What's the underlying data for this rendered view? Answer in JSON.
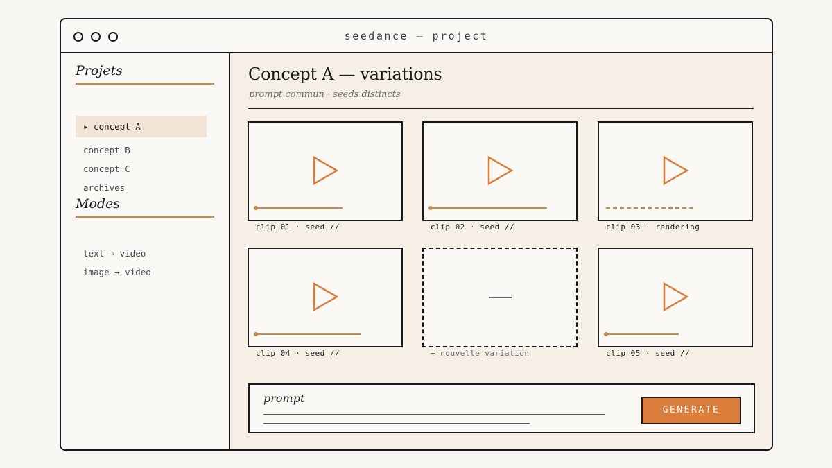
{
  "window": {
    "title": "seedance — project"
  },
  "sidebar": {
    "projects_heading": "Projets",
    "projects": [
      {
        "label": "▸ concept A",
        "active": true
      },
      {
        "label": "concept B"
      },
      {
        "label": "concept C"
      },
      {
        "label": "archives"
      }
    ],
    "modes_heading": "Modes",
    "modes": [
      {
        "label": "text → video"
      },
      {
        "label": "image → video"
      }
    ]
  },
  "main": {
    "title": "Concept A — variations",
    "subtitle": "prompt commun · seeds distincts",
    "clips": [
      {
        "caption": "clip 01 · seed //",
        "status": "ready",
        "progress": 0.58
      },
      {
        "caption": "clip 02 · seed //",
        "status": "ready",
        "progress": 0.78
      },
      {
        "caption": "clip 03 · rendering",
        "status": "rendering"
      },
      {
        "caption": "clip 04 · seed //",
        "status": "ready",
        "progress": 0.7
      },
      {
        "caption": "+ nouvelle variation",
        "status": "empty"
      },
      {
        "caption": "clip 05 · seed //",
        "status": "ready",
        "progress": 0.49
      }
    ]
  },
  "prompt": {
    "label": "prompt",
    "generate_label": "GENERATE"
  },
  "colors": {
    "accent": "#db7e3b",
    "accent_line": "#c98748",
    "ink": "#1a1a1a",
    "panel": "#f5efe6"
  },
  "icons": {
    "play": "play-icon"
  }
}
